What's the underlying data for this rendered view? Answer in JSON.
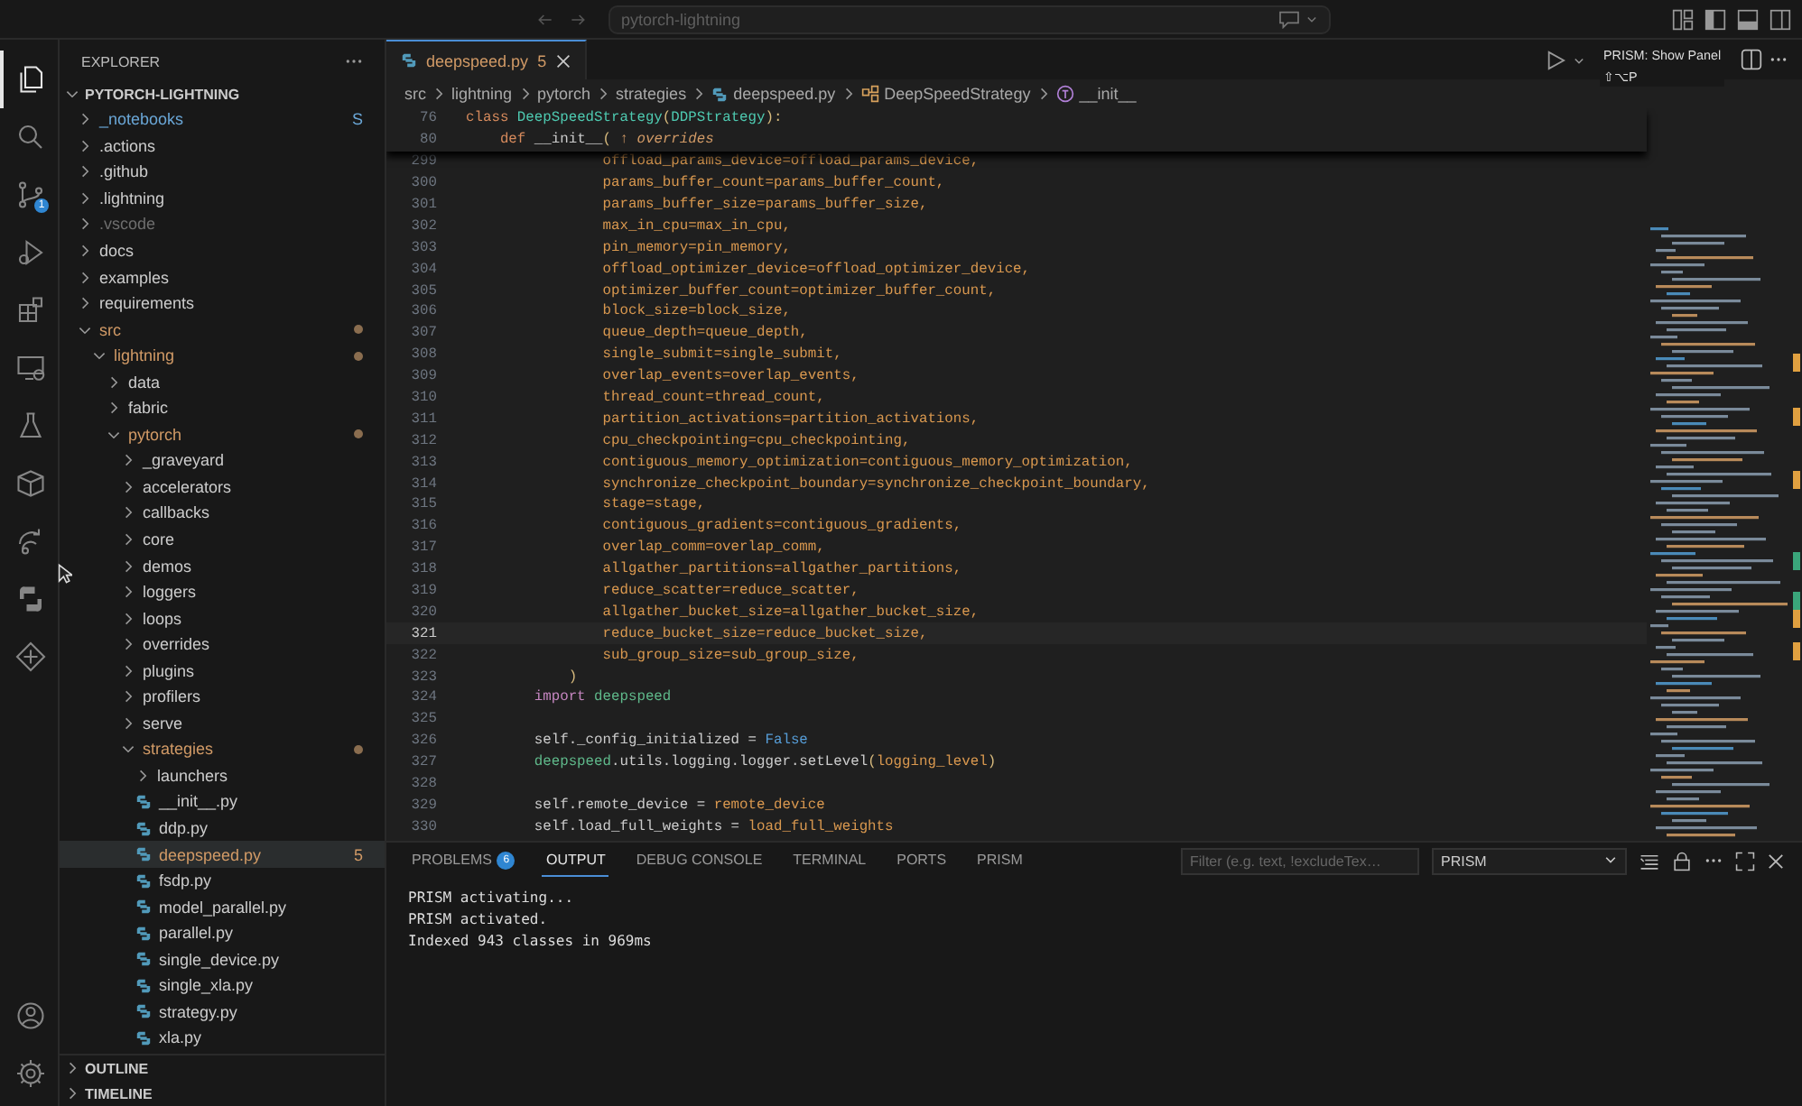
{
  "title_bar": {
    "search": "pytorch-lightning"
  },
  "tooltip": {
    "title": "PRISM: Show Panel",
    "shortcut": "⇧⌥P"
  },
  "activity_bar": {
    "items": [
      {
        "kind": "explorer",
        "selected": true
      },
      {
        "kind": "search",
        "selected": false
      },
      {
        "kind": "source-control",
        "selected": false,
        "badge": "1"
      },
      {
        "kind": "run-debug",
        "selected": false
      },
      {
        "kind": "extensions",
        "selected": false
      },
      {
        "kind": "remote",
        "selected": false
      },
      {
        "kind": "testing",
        "selected": false
      },
      {
        "kind": "package",
        "selected": false
      },
      {
        "kind": "share",
        "selected": false
      },
      {
        "kind": "python",
        "selected": false
      },
      {
        "kind": "diamond",
        "selected": false
      }
    ],
    "bottom": [
      {
        "kind": "account"
      },
      {
        "kind": "settings"
      }
    ]
  },
  "sidebar": {
    "title": "EXPLORER",
    "root": "PYTORCH-LIGHTNING",
    "tree": [
      {
        "label": "_notebooks",
        "kind": "folder",
        "expanded": false,
        "selected": false,
        "modified": false,
        "color": "#6aa6d6",
        "badge": "S"
      },
      {
        "label": ".actions",
        "kind": "folder",
        "expanded": false,
        "selected": false,
        "modified": false,
        "color": "#cccccc"
      },
      {
        "label": ".github",
        "kind": "folder",
        "expanded": false,
        "selected": false,
        "modified": false,
        "color": "#cccccc"
      },
      {
        "label": ".lightning",
        "kind": "folder",
        "expanded": false,
        "selected": false,
        "modified": false,
        "color": "#cccccc"
      },
      {
        "label": ".vscode",
        "kind": "folder",
        "expanded": false,
        "selected": false,
        "modified": false,
        "color": "#6e6e6e"
      },
      {
        "label": "docs",
        "kind": "folder",
        "expanded": false,
        "selected": false,
        "modified": false,
        "color": "#cccccc"
      },
      {
        "label": "examples",
        "kind": "folder",
        "expanded": false,
        "selected": false,
        "modified": false,
        "color": "#cccccc"
      },
      {
        "label": "requirements",
        "kind": "folder",
        "expanded": false,
        "selected": false,
        "modified": false,
        "color": "#cccccc"
      },
      {
        "label": "src",
        "kind": "folder",
        "expanded": true,
        "selected": false,
        "modified": true,
        "color": "#d19a66",
        "children": [
          {
            "label": "lightning",
            "kind": "folder",
            "expanded": true,
            "selected": false,
            "modified": true,
            "color": "#d19a66",
            "children": [
              {
                "label": "data",
                "kind": "folder",
                "expanded": false,
                "selected": false,
                "modified": false,
                "color": "#cccccc"
              },
              {
                "label": "fabric",
                "kind": "folder",
                "expanded": false,
                "selected": false,
                "modified": false,
                "color": "#cccccc"
              },
              {
                "label": "pytorch",
                "kind": "folder",
                "expanded": true,
                "selected": false,
                "modified": true,
                "color": "#d19a66",
                "children": [
                  {
                    "label": "_graveyard",
                    "kind": "folder",
                    "expanded": false,
                    "selected": false,
                    "modified": false,
                    "color": "#cccccc"
                  },
                  {
                    "label": "accelerators",
                    "kind": "folder",
                    "expanded": false,
                    "selected": false,
                    "modified": false,
                    "color": "#cccccc"
                  },
                  {
                    "label": "callbacks",
                    "kind": "folder",
                    "expanded": false,
                    "selected": false,
                    "modified": false,
                    "color": "#cccccc"
                  },
                  {
                    "label": "core",
                    "kind": "folder",
                    "expanded": false,
                    "selected": false,
                    "modified": false,
                    "color": "#cccccc"
                  },
                  {
                    "label": "demos",
                    "kind": "folder",
                    "expanded": false,
                    "selected": false,
                    "modified": false,
                    "color": "#cccccc"
                  },
                  {
                    "label": "loggers",
                    "kind": "folder",
                    "expanded": false,
                    "selected": false,
                    "modified": false,
                    "color": "#cccccc"
                  },
                  {
                    "label": "loops",
                    "kind": "folder",
                    "expanded": false,
                    "selected": false,
                    "modified": false,
                    "color": "#cccccc"
                  },
                  {
                    "label": "overrides",
                    "kind": "folder",
                    "expanded": false,
                    "selected": false,
                    "modified": false,
                    "color": "#cccccc"
                  },
                  {
                    "label": "plugins",
                    "kind": "folder",
                    "expanded": false,
                    "selected": false,
                    "modified": false,
                    "color": "#cccccc"
                  },
                  {
                    "label": "profilers",
                    "kind": "folder",
                    "expanded": false,
                    "selected": false,
                    "modified": false,
                    "color": "#cccccc"
                  },
                  {
                    "label": "serve",
                    "kind": "folder",
                    "expanded": false,
                    "selected": false,
                    "modified": false,
                    "color": "#cccccc"
                  },
                  {
                    "label": "strategies",
                    "kind": "folder",
                    "expanded": true,
                    "selected": false,
                    "modified": true,
                    "color": "#d19a66",
                    "children": [
                      {
                        "label": "launchers",
                        "kind": "folder",
                        "expanded": false,
                        "selected": false,
                        "modified": false,
                        "color": "#cccccc"
                      },
                      {
                        "label": "__init__.py",
                        "kind": "file",
                        "selected": false,
                        "color": "#cccccc"
                      },
                      {
                        "label": "ddp.py",
                        "kind": "file",
                        "selected": false,
                        "color": "#cccccc"
                      },
                      {
                        "label": "deepspeed.py",
                        "kind": "file",
                        "selected": true,
                        "color": "#d19a66",
                        "badge": "5"
                      },
                      {
                        "label": "fsdp.py",
                        "kind": "file",
                        "selected": false,
                        "color": "#cccccc"
                      },
                      {
                        "label": "model_parallel.py",
                        "kind": "file",
                        "selected": false,
                        "color": "#cccccc"
                      },
                      {
                        "label": "parallel.py",
                        "kind": "file",
                        "selected": false,
                        "color": "#cccccc"
                      },
                      {
                        "label": "single_device.py",
                        "kind": "file",
                        "selected": false,
                        "color": "#cccccc"
                      },
                      {
                        "label": "single_xla.py",
                        "kind": "file",
                        "selected": false,
                        "color": "#cccccc"
                      },
                      {
                        "label": "strategy.py",
                        "kind": "file",
                        "selected": false,
                        "color": "#cccccc"
                      },
                      {
                        "label": "xla.py",
                        "kind": "file",
                        "selected": false,
                        "color": "#cccccc"
                      }
                    ]
                  }
                ]
              }
            ]
          }
        ]
      }
    ],
    "sections": [
      {
        "label": "OUTLINE",
        "expanded": false
      },
      {
        "label": "TIMELINE",
        "expanded": false
      }
    ]
  },
  "editor": {
    "tab": {
      "label": "deepspeed.py",
      "badge": "5",
      "selected": true
    },
    "breadcrumbs": [
      {
        "label": "src",
        "kind": "folder"
      },
      {
        "label": "lightning",
        "kind": "folder"
      },
      {
        "label": "pytorch",
        "kind": "folder"
      },
      {
        "label": "strategies",
        "kind": "folder"
      },
      {
        "label": "deepspeed.py",
        "kind": "file"
      },
      {
        "label": "DeepSpeedStrategy",
        "kind": "class"
      },
      {
        "label": "__init__",
        "kind": "method"
      }
    ],
    "sticky": [
      {
        "num": "76",
        "tokens": [
          {
            "t": "class ",
            "kind": "keyword"
          },
          {
            "t": "DeepSpeedStrategy",
            "kind": "class"
          },
          {
            "t": "(",
            "kind": "bracket"
          },
          {
            "t": "DDPStrategy",
            "kind": "class"
          },
          {
            "t": "):",
            "kind": "bracket"
          }
        ]
      },
      {
        "num": "80",
        "tokens": [
          {
            "t": "    def ",
            "kind": "keyword"
          },
          {
            "t": "__init__",
            "kind": "plain"
          },
          {
            "t": "( ",
            "kind": "bracket"
          },
          {
            "t": "↑ overrides",
            "kind": "hint"
          }
        ]
      }
    ],
    "lines": [
      {
        "num": "299",
        "current": false,
        "tokens": [
          {
            "t": "                offload_params_device=offload_params_device,",
            "kind": "param"
          }
        ]
      },
      {
        "num": "300",
        "current": false,
        "tokens": [
          {
            "t": "                params_buffer_count=params_buffer_count,",
            "kind": "param"
          }
        ]
      },
      {
        "num": "301",
        "current": false,
        "tokens": [
          {
            "t": "                params_buffer_size=params_buffer_size,",
            "kind": "param"
          }
        ]
      },
      {
        "num": "302",
        "current": false,
        "tokens": [
          {
            "t": "                max_in_cpu=max_in_cpu,",
            "kind": "param"
          }
        ]
      },
      {
        "num": "303",
        "current": false,
        "tokens": [
          {
            "t": "                pin_memory=pin_memory,",
            "kind": "param"
          }
        ]
      },
      {
        "num": "304",
        "current": false,
        "tokens": [
          {
            "t": "                offload_optimizer_device=offload_optimizer_device,",
            "kind": "param"
          }
        ]
      },
      {
        "num": "305",
        "current": false,
        "tokens": [
          {
            "t": "                optimizer_buffer_count=optimizer_buffer_count,",
            "kind": "param"
          }
        ]
      },
      {
        "num": "306",
        "current": false,
        "tokens": [
          {
            "t": "                block_size=block_size,",
            "kind": "param"
          }
        ]
      },
      {
        "num": "307",
        "current": false,
        "tokens": [
          {
            "t": "                queue_depth=queue_depth,",
            "kind": "param"
          }
        ]
      },
      {
        "num": "308",
        "current": false,
        "tokens": [
          {
            "t": "                single_submit=single_submit,",
            "kind": "param"
          }
        ]
      },
      {
        "num": "309",
        "current": false,
        "tokens": [
          {
            "t": "                overlap_events=overlap_events,",
            "kind": "param"
          }
        ]
      },
      {
        "num": "310",
        "current": false,
        "tokens": [
          {
            "t": "                thread_count=thread_count,",
            "kind": "param"
          }
        ]
      },
      {
        "num": "311",
        "current": false,
        "tokens": [
          {
            "t": "                partition_activations=partition_activations,",
            "kind": "param"
          }
        ]
      },
      {
        "num": "312",
        "current": false,
        "tokens": [
          {
            "t": "                cpu_checkpointing=cpu_checkpointing,",
            "kind": "param"
          }
        ]
      },
      {
        "num": "313",
        "current": false,
        "tokens": [
          {
            "t": "                contiguous_memory_optimization=contiguous_memory_optimization,",
            "kind": "param"
          }
        ]
      },
      {
        "num": "314",
        "current": false,
        "tokens": [
          {
            "t": "                synchronize_checkpoint_boundary=synchronize_checkpoint_boundary,",
            "kind": "param"
          }
        ]
      },
      {
        "num": "315",
        "current": false,
        "tokens": [
          {
            "t": "                stage=stage,",
            "kind": "param"
          }
        ]
      },
      {
        "num": "316",
        "current": false,
        "tokens": [
          {
            "t": "                contiguous_gradients=contiguous_gradients,",
            "kind": "param"
          }
        ]
      },
      {
        "num": "317",
        "current": false,
        "tokens": [
          {
            "t": "                overlap_comm=overlap_comm,",
            "kind": "param"
          }
        ]
      },
      {
        "num": "318",
        "current": false,
        "tokens": [
          {
            "t": "                allgather_partitions=allgather_partitions,",
            "kind": "param"
          }
        ]
      },
      {
        "num": "319",
        "current": false,
        "tokens": [
          {
            "t": "                reduce_scatter=reduce_scatter,",
            "kind": "param"
          }
        ]
      },
      {
        "num": "320",
        "current": false,
        "tokens": [
          {
            "t": "                allgather_bucket_size=allgather_bucket_size,",
            "kind": "param"
          }
        ]
      },
      {
        "num": "321",
        "current": true,
        "tokens": [
          {
            "t": "                reduce_bucket_size=reduce_bucket_size,",
            "kind": "param"
          }
        ]
      },
      {
        "num": "322",
        "current": false,
        "tokens": [
          {
            "t": "                sub_group_size=sub_group_size,",
            "kind": "param"
          }
        ]
      },
      {
        "num": "323",
        "current": false,
        "tokens": [
          {
            "t": "            )",
            "kind": "bracket"
          }
        ]
      },
      {
        "num": "324",
        "current": false,
        "tokens": [
          {
            "t": "        import ",
            "kind": "import"
          },
          {
            "t": "deepspeed",
            "kind": "module"
          }
        ]
      },
      {
        "num": "325",
        "current": false
      },
      {
        "num": "326",
        "current": false,
        "tokens": [
          {
            "t": "        self._config_initialized = ",
            "kind": "plain"
          },
          {
            "t": "False",
            "kind": "const"
          }
        ]
      },
      {
        "num": "327",
        "current": false,
        "tokens": [
          {
            "t": "        deepspeed",
            "kind": "module"
          },
          {
            "t": ".utils.logging.logger.setLevel",
            "kind": "plain"
          },
          {
            "t": "(",
            "kind": "bracket"
          },
          {
            "t": "logging_level",
            "kind": "param"
          },
          {
            "t": ")",
            "kind": "bracket"
          }
        ]
      },
      {
        "num": "328",
        "current": false
      },
      {
        "num": "329",
        "current": false,
        "tokens": [
          {
            "t": "        self.remote_device = ",
            "kind": "plain"
          },
          {
            "t": "remote_device",
            "kind": "param"
          }
        ]
      },
      {
        "num": "330",
        "current": false,
        "tokens": [
          {
            "t": "        self.load_full_weights = ",
            "kind": "plain"
          },
          {
            "t": "load_full_weights",
            "kind": "param"
          }
        ]
      }
    ]
  },
  "panel": {
    "tabs": [
      {
        "label": "PROBLEMS",
        "selected": false,
        "badge": "6"
      },
      {
        "label": "OUTPUT",
        "selected": true
      },
      {
        "label": "DEBUG CONSOLE",
        "selected": false
      },
      {
        "label": "TERMINAL",
        "selected": false
      },
      {
        "label": "PORTS",
        "selected": false
      },
      {
        "label": "PRISM",
        "selected": false
      }
    ],
    "filter": {
      "placeholder": "Filter (e.g. text, !excludeTex…"
    },
    "channel": "PRISM",
    "output": [
      "PRISM activating...",
      "PRISM activated.",
      "Indexed 943 classes in 969ms"
    ]
  }
}
